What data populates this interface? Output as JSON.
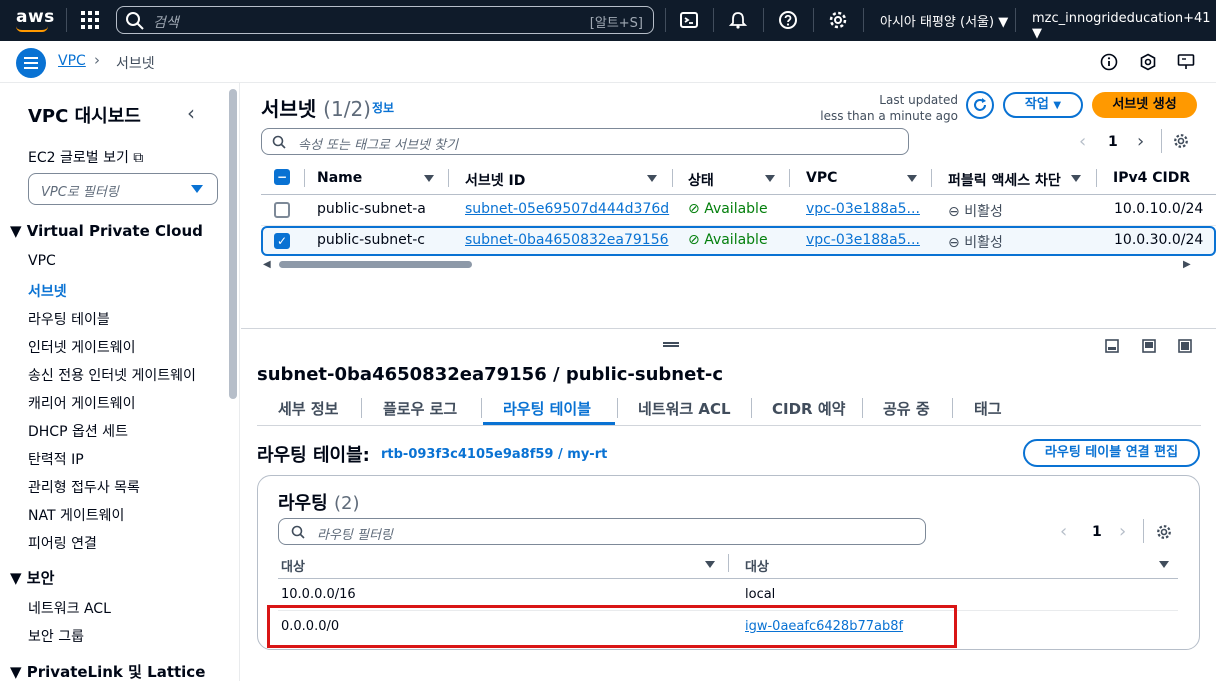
{
  "topnav": {
    "logo": "aws",
    "search_placeholder": "검색",
    "search_shortcut": "[알트+S]",
    "region": "아시아 태평양 (서울) ▼",
    "account": "mzc_innogrideducation+41 ▼"
  },
  "breadcrumb": {
    "root": "VPC",
    "current": "서브넷"
  },
  "sidenav": {
    "title": "VPC 대시보드",
    "ec2_global": "EC2 글로벌 보기",
    "filter_placeholder": "VPC로 필터링",
    "sections": [
      {
        "label": "Virtual Private Cloud",
        "items": [
          "VPC",
          "서브넷",
          "라우팅 테이블",
          "인터넷 게이트웨이",
          "송신 전용 인터넷 게이트웨이",
          "캐리어 게이트웨이",
          "DHCP 옵션 세트",
          "탄력적 IP",
          "관리형 접두사 목록",
          "NAT 게이트웨이",
          "피어링 연결"
        ]
      },
      {
        "label": "보안",
        "items": [
          "네트워크 ACL",
          "보안 그룹"
        ]
      },
      {
        "label": "PrivateLink 및 Lattice",
        "items": []
      }
    ],
    "active_item": "서브넷"
  },
  "subnets": {
    "title": "서브넷",
    "count": "(1/2)",
    "info": "정보",
    "last_updated_label": "Last updated",
    "last_updated_value": "less than a minute ago",
    "actions_label": "작업",
    "create_label": "서브넷 생성",
    "search_placeholder": "속성 또는 태그로 서브넷 찾기",
    "page": "1",
    "columns": [
      "Name",
      "서브넷 ID",
      "상태",
      "VPC",
      "퍼블릭 액세스 차단",
      "IPv4 CIDR"
    ],
    "rows": [
      {
        "name": "public-subnet-a",
        "subnet_id": "subnet-05e69507d444d376d",
        "state": "Available",
        "vpc": "vpc-03e188a5...",
        "bpa": "비활성",
        "cidr": "10.0.10.0/24",
        "selected": false
      },
      {
        "name": "public-subnet-c",
        "subnet_id": "subnet-0ba4650832ea79156",
        "state": "Available",
        "vpc": "vpc-03e188a5...",
        "bpa": "비활성",
        "cidr": "10.0.30.0/24",
        "selected": true
      }
    ]
  },
  "detail": {
    "title": "subnet-0ba4650832ea79156 / public-subnet-c",
    "tabs": [
      "세부 정보",
      "플로우 로그",
      "라우팅 테이블",
      "네트워크 ACL",
      "CIDR 예약",
      "공유 중",
      "태그"
    ],
    "active_tab": "라우팅 테이블",
    "route_table_label": "라우팅 테이블:",
    "route_table_link": "rtb-093f3c4105e9a8f59 / my-rt",
    "edit_button": "라우팅 테이블 연결 편집",
    "routes_title": "라우팅",
    "routes_count": "(2)",
    "routes_filter_placeholder": "라우팅 필터링",
    "page": "1",
    "columns": [
      "대상",
      "대상"
    ],
    "routes": [
      {
        "destination": "10.0.0.0/16",
        "target": "local",
        "target_is_link": false,
        "highlighted": false
      },
      {
        "destination": "0.0.0.0/0",
        "target": "igw-0aeafc6428b77ab8f",
        "target_is_link": true,
        "highlighted": true
      }
    ],
    "highlight_color": "#d91515"
  }
}
